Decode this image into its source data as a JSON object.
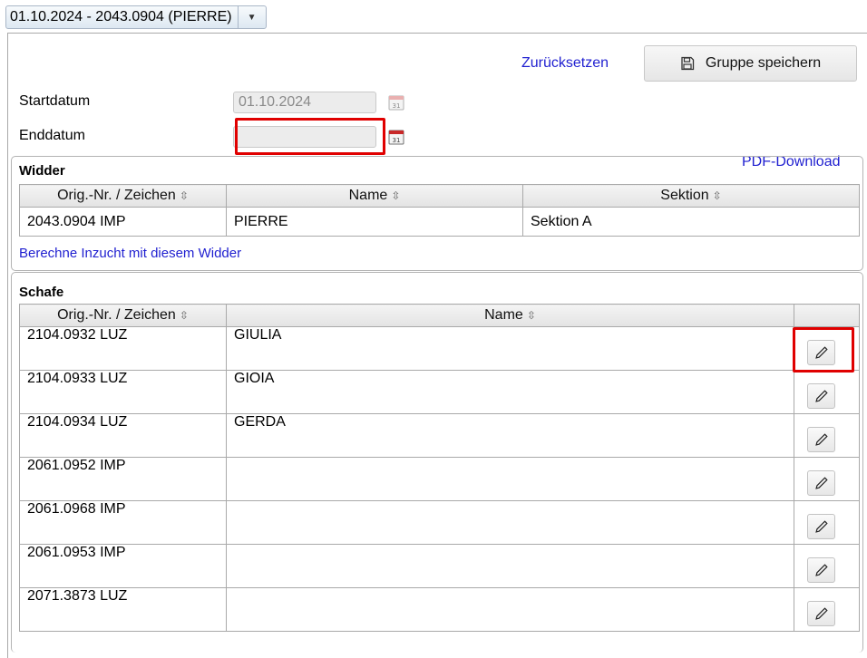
{
  "group_selector": {
    "value": "01.10.2024 - 2043.0904 (PIERRE)",
    "arrow_icon": "chevron-down-icon"
  },
  "actions": {
    "reset_label": "Zurücksetzen",
    "save_label": "Gruppe speichern",
    "save_icon": "floppy-disk-icon",
    "pdf_label": "PDF-Download"
  },
  "form": {
    "start_label": "Startdatum",
    "start_value": "01.10.2024",
    "end_label": "Enddatum",
    "end_value": ""
  },
  "ram": {
    "title": "Widder",
    "columns": [
      "Orig.-Nr. / Zeichen",
      "Name",
      "Sektion"
    ],
    "rows": [
      {
        "nr": "2043.0904 IMP",
        "name": "PIERRE",
        "section": "Sektion A"
      }
    ],
    "calc_link": "Berechne Inzucht mit diesem Widder"
  },
  "sheep": {
    "title": "Schafe",
    "columns": [
      "Orig.-Nr. / Zeichen",
      "Name"
    ],
    "rows": [
      {
        "nr": "2104.0932 LUZ",
        "name": "GIULIA"
      },
      {
        "nr": "2104.0933 LUZ",
        "name": "GIOIA"
      },
      {
        "nr": "2104.0934 LUZ",
        "name": "GERDA"
      },
      {
        "nr": "2061.0952 IMP",
        "name": ""
      },
      {
        "nr": "2061.0968 IMP",
        "name": ""
      },
      {
        "nr": "2061.0953 IMP",
        "name": ""
      },
      {
        "nr": "2071.3873 LUZ",
        "name": ""
      }
    ]
  },
  "colors": {
    "link": "#1f1fd0",
    "highlight": "#e00000",
    "border": "#a9a9a9"
  }
}
